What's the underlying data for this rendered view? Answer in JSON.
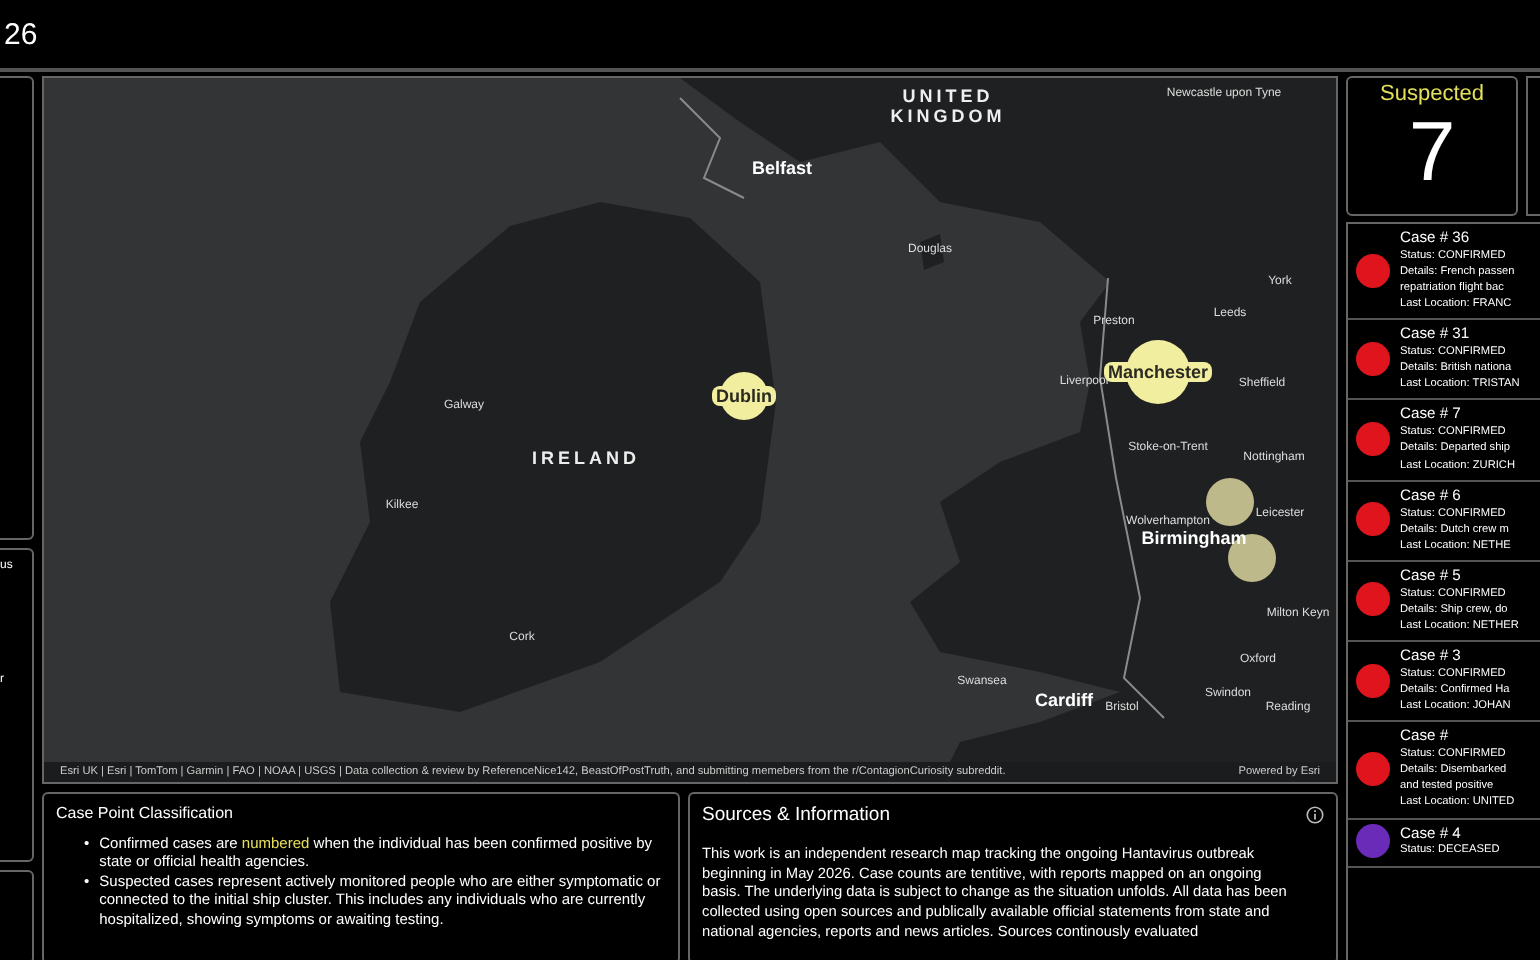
{
  "header": {
    "title": "26"
  },
  "left_panels": [
    {
      "text": "us"
    },
    {
      "text": "r"
    }
  ],
  "map": {
    "labels": [
      {
        "text": "UNITED KINGDOM",
        "kind": "country"
      },
      {
        "text": "Newcastle upon Tyne",
        "kind": "town"
      },
      {
        "text": "Belfast",
        "kind": "city"
      },
      {
        "text": "Douglas",
        "kind": "town"
      },
      {
        "text": "York",
        "kind": "town"
      },
      {
        "text": "Preston",
        "kind": "town"
      },
      {
        "text": "Leeds",
        "kind": "town"
      },
      {
        "text": "Galway",
        "kind": "town"
      },
      {
        "text": "Liverpool",
        "kind": "town"
      },
      {
        "text": "Sheffield",
        "kind": "town"
      },
      {
        "text": "IRELAND",
        "kind": "country"
      },
      {
        "text": "Stoke-on-Trent",
        "kind": "town"
      },
      {
        "text": "Nottingham",
        "kind": "town"
      },
      {
        "text": "Kilkee",
        "kind": "town"
      },
      {
        "text": "Wolverhampton",
        "kind": "town"
      },
      {
        "text": "Leicester",
        "kind": "town"
      },
      {
        "text": "Birmingham",
        "kind": "city"
      },
      {
        "text": "Milton Keyn",
        "kind": "town"
      },
      {
        "text": "Cork",
        "kind": "town"
      },
      {
        "text": "Oxford",
        "kind": "town"
      },
      {
        "text": "Swansea",
        "kind": "town"
      },
      {
        "text": "Cardiff",
        "kind": "city"
      },
      {
        "text": "Bristol",
        "kind": "town"
      },
      {
        "text": "Swindon",
        "kind": "town"
      },
      {
        "text": "Reading",
        "kind": "town"
      },
      {
        "text": "Dublin",
        "kind": "city"
      },
      {
        "text": "Manchester",
        "kind": "city"
      }
    ],
    "attribution": "Esri UK | Esri | TomTom | Garmin | FAO | NOAA | USGS | Data collection & review by ReferenceNice142, BeastOfPostTruth, and submitting memebers from the r/ContagionCuriosity subreddit.",
    "powered_by": "Powered by Esri"
  },
  "classification": {
    "title": "Case Point Classification",
    "bullets": [
      {
        "marker": "•",
        "parts": [
          {
            "text": "Confirmed cases are ",
            "highlight": false
          },
          {
            "text": "numbered",
            "highlight": true
          },
          {
            "text": " when the individual has been confirmed positive by state or official health agencies.",
            "highlight": false
          }
        ]
      },
      {
        "marker": "•",
        "parts": [
          {
            "text": "Suspected cases represent actively monitored people who are either symptomatic or connected to the initial ship cluster. This includes any individuals who are currently hospitalized, showing symptoms or awaiting testing.",
            "highlight": false
          }
        ]
      }
    ]
  },
  "sources": {
    "title": "Sources & Information",
    "text": "This work is an independent research map tracking the ongoing Hantavirus outbreak beginning in May 2026. Case counts are tentitive, with reports mapped on an ongoing basis. The underlying data is subject to change as the situation unfolds. All data has been collected using open sources and publically available official statements from state and national agencies, reports and news articles. Sources continously evaluated"
  },
  "suspected": {
    "label": "Suspected",
    "value": "7"
  },
  "cases": [
    {
      "title": "Case # 36",
      "status": "Status: CONFIRMED",
      "details": [
        "Details: French passen",
        "repatriation flight bac"
      ],
      "location": "Last Location: FRANC",
      "color": "#e0141c"
    },
    {
      "title": "Case # 31",
      "status": "Status: CONFIRMED",
      "details": [
        "Details: British nationa"
      ],
      "location": "Last Location: TRISTAN",
      "color": "#e0141c"
    },
    {
      "title": "Case # 7",
      "status": "Status: CONFIRMED",
      "details": [
        "Details: Departed ship"
      ],
      "location": "Last Location: ZURICH",
      "color": "#e0141c"
    },
    {
      "title": "Case # 6",
      "status": "Status: CONFIRMED",
      "details": [
        "Details: Dutch crew m"
      ],
      "location": "Last Location: NETHE",
      "color": "#e0141c"
    },
    {
      "title": "Case # 5",
      "status": "Status: CONFIRMED",
      "details": [
        "Details: Ship crew, do"
      ],
      "location": "Last Location: NETHER",
      "color": "#e0141c"
    },
    {
      "title": "Case # 3",
      "status": "Status: CONFIRMED",
      "details": [
        "Details: Confirmed Ha"
      ],
      "location": "Last Location: JOHAN",
      "color": "#e0141c"
    },
    {
      "title": "Case #",
      "status": "Status: CONFIRMED",
      "details": [
        "Details: Disembarked",
        "and tested positive"
      ],
      "location": "Last Location: UNITED",
      "color": "#e0141c"
    },
    {
      "title": "Case # 4",
      "status": "Status: DECEASED",
      "color": "#6a2bb8"
    }
  ]
}
